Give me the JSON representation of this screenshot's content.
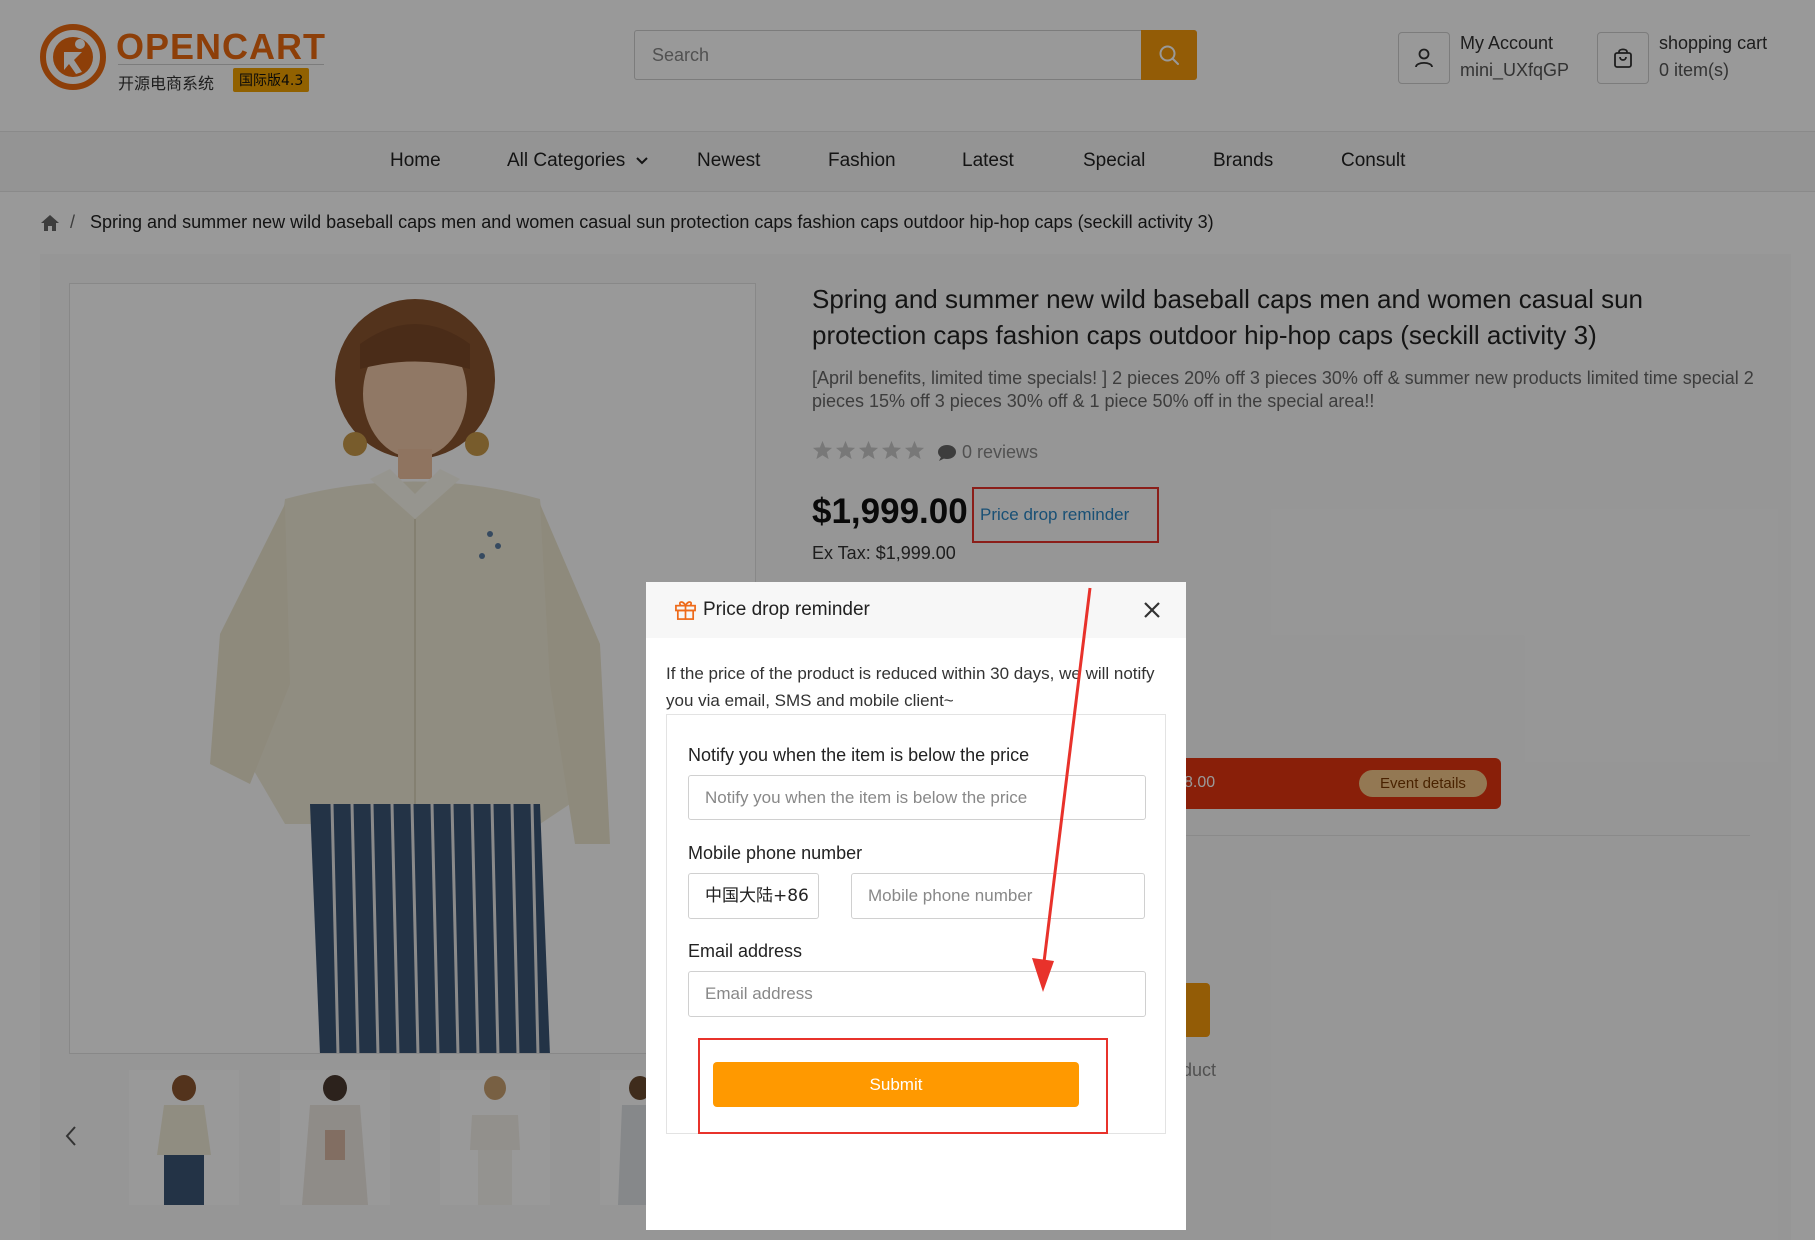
{
  "header": {
    "logo": {
      "title": "OPENCART",
      "subtitle": "开源电商系统",
      "version": "国际版4.3"
    },
    "search": {
      "placeholder": "Search",
      "icon": "search-icon"
    },
    "account": {
      "title": "My Account",
      "username": "mini_UXfqGP",
      "icon": "user-icon"
    },
    "cart": {
      "title": "shopping cart",
      "items": "0 item(s)",
      "icon": "cart-icon"
    }
  },
  "nav": {
    "items": [
      {
        "label": "Home"
      },
      {
        "label": "All Categories",
        "icon": "chevron-down-icon"
      },
      {
        "label": "Newest"
      },
      {
        "label": "Fashion"
      },
      {
        "label": "Latest"
      },
      {
        "label": "Special"
      },
      {
        "label": "Brands"
      },
      {
        "label": "Consult"
      }
    ]
  },
  "breadcrumb": {
    "home_icon": "home-icon",
    "separator": "/",
    "current": "Spring and summer new wild baseball caps men and women casual sun protection caps fashion caps outdoor hip-hop caps (seckill activity 3)"
  },
  "product": {
    "title": "Spring and summer new wild baseball caps men and women casual sun protection caps fashion caps outdoor hip-hop caps (seckill activity 3)",
    "description": "[April benefits, limited time specials! ] 2 pieces 20% off 3 pieces 30% off & summer new products limited time special 2 pieces 15% off 3 pieces 30% off & 1 piece 50% off in the special area!!",
    "rating": 0,
    "rating_max": 5,
    "reviews": "0 reviews",
    "price": "$1,999.00",
    "price_drop_link": "Price drop reminder",
    "ex_tax": "Ex Tax: $1,999.00",
    "event_price_partial": "8.00",
    "event_details": "Event details",
    "product_partial": "oduct"
  },
  "modal": {
    "title": "Price drop reminder",
    "icon": "gift-icon",
    "close_icon": "close-icon",
    "description": "If the price of the product is reduced within 30 days, we will notify you via email, SMS and mobile client~",
    "fields": {
      "price": {
        "label": "Notify you when the item is below the price",
        "placeholder": "Notify you when the item is below the price"
      },
      "phone": {
        "label": "Mobile phone number",
        "country_code": "中国大陆+86",
        "placeholder": "Mobile phone number"
      },
      "email": {
        "label": "Email address",
        "placeholder": "Email address"
      }
    },
    "submit": "Submit"
  },
  "colors": {
    "accent": "#f59a0b",
    "brand": "#ec6a10",
    "highlight": "#e8322b",
    "link": "#2a86c4",
    "event_bar": "#e4340f"
  }
}
